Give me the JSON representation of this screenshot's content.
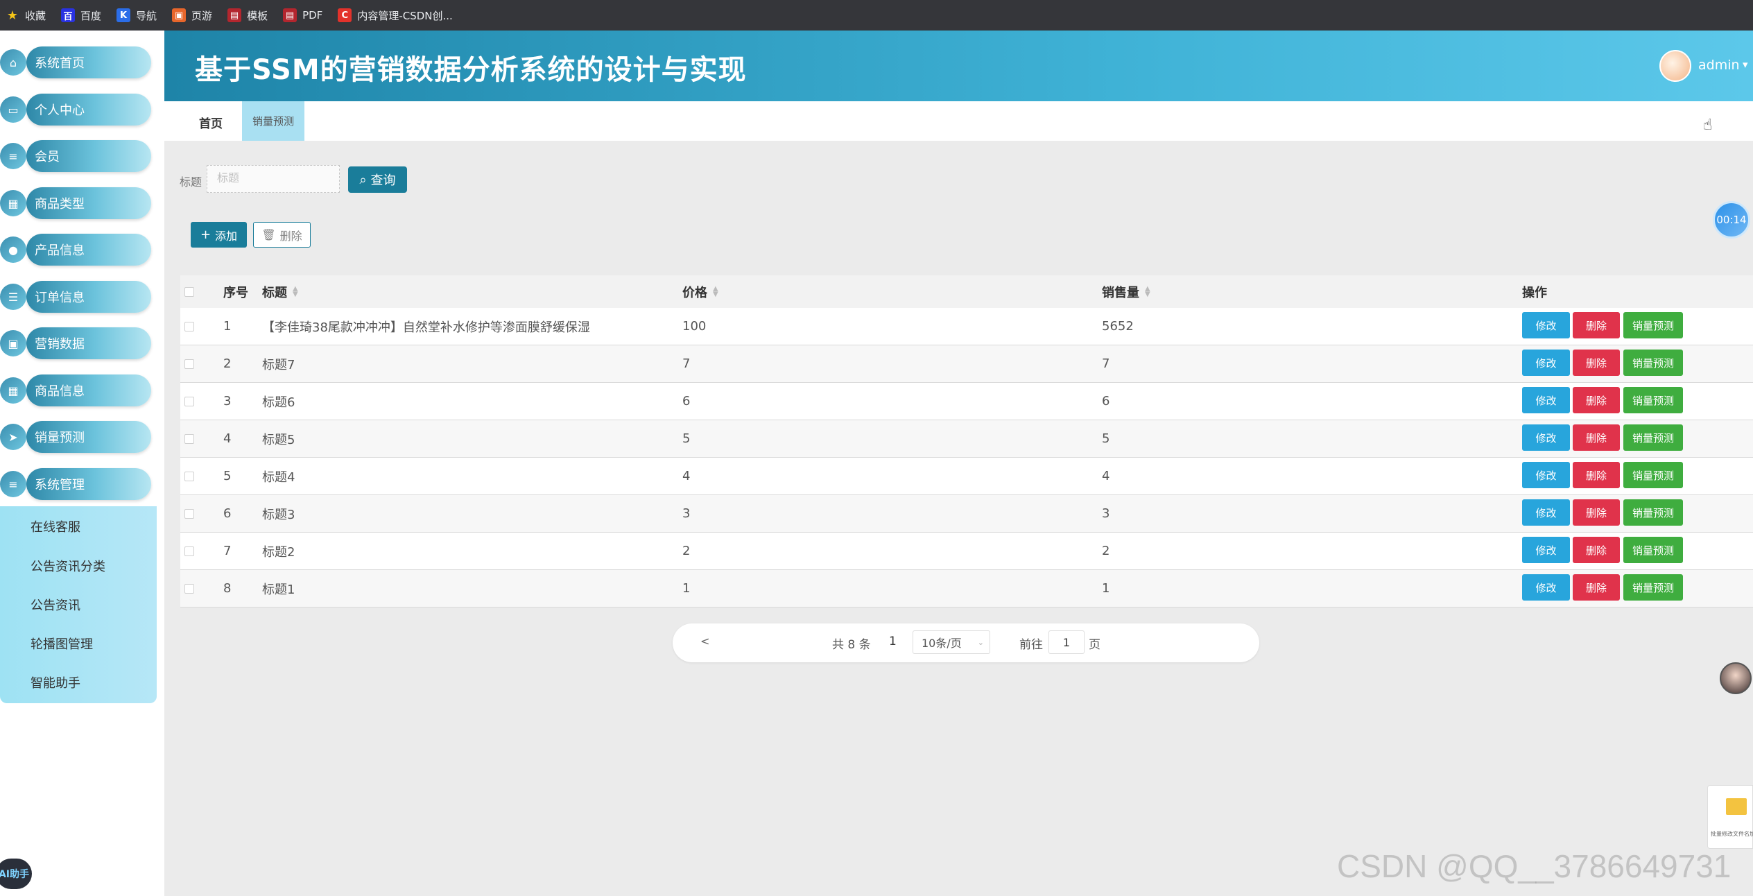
{
  "bookmarks": [
    {
      "label": "收藏",
      "icon": "star-icon",
      "color": "#f5c518"
    },
    {
      "label": "百度",
      "icon": "baidu-icon",
      "color": "#2932e1"
    },
    {
      "label": "导航",
      "icon": "nav-icon",
      "color": "#2b6de8"
    },
    {
      "label": "页游",
      "icon": "game-icon",
      "color": "#e8662b"
    },
    {
      "label": "模板",
      "icon": "template-icon",
      "color": "#b3262e"
    },
    {
      "label": "PDF",
      "icon": "pdf-icon",
      "color": "#b3262e"
    },
    {
      "label": "内容管理-CSDN创...",
      "icon": "csdn-icon",
      "color": "#e3322b"
    }
  ],
  "sidebar": {
    "items": [
      {
        "label": "系统首页",
        "icon": "home-icon"
      },
      {
        "label": "个人中心",
        "icon": "profile-icon"
      },
      {
        "label": "会员",
        "icon": "list-icon"
      },
      {
        "label": "商品类型",
        "icon": "grid-icon"
      },
      {
        "label": "产品信息",
        "icon": "bulb-icon"
      },
      {
        "label": "订单信息",
        "icon": "sliders-icon"
      },
      {
        "label": "营销数据",
        "icon": "camera-icon"
      },
      {
        "label": "商品信息",
        "icon": "grid-icon"
      },
      {
        "label": "销量预测",
        "icon": "send-icon"
      },
      {
        "label": "系统管理",
        "icon": "list-icon"
      }
    ],
    "submenu": [
      "在线客服",
      "公告资讯分类",
      "公告资讯",
      "轮播图管理",
      "智能助手"
    ],
    "ai_badge": "AI助手"
  },
  "header": {
    "title": "基于SSM的营销数据分析系统的设计与实现",
    "user": "admin"
  },
  "tabs": {
    "home": "首页",
    "active": "销量预测"
  },
  "search": {
    "label": "标题",
    "placeholder": "标题",
    "button": "查询"
  },
  "actions": {
    "add": "添加",
    "delete": "删除"
  },
  "timer": "00:14",
  "table": {
    "headers": {
      "index": "序号",
      "title": "标题",
      "price": "价格",
      "sales": "销售量",
      "ops": "操作"
    },
    "rows": [
      {
        "index": "1",
        "title": "【李佳琦38尾款冲冲冲】自然堂补水修护等渗面膜舒缓保湿",
        "price": "100",
        "sales": "5652"
      },
      {
        "index": "2",
        "title": "标题7",
        "price": "7",
        "sales": "7"
      },
      {
        "index": "3",
        "title": "标题6",
        "price": "6",
        "sales": "6"
      },
      {
        "index": "4",
        "title": "标题5",
        "price": "5",
        "sales": "5"
      },
      {
        "index": "5",
        "title": "标题4",
        "price": "4",
        "sales": "4"
      },
      {
        "index": "6",
        "title": "标题3",
        "price": "3",
        "sales": "3"
      },
      {
        "index": "7",
        "title": "标题2",
        "price": "2",
        "sales": "2"
      },
      {
        "index": "8",
        "title": "标题1",
        "price": "1",
        "sales": "1"
      }
    ],
    "row_buttons": {
      "edit": "修改",
      "remove": "删除",
      "predict": "销量预测"
    }
  },
  "pagination": {
    "prev": "<",
    "total": "共 8 条",
    "current": "1",
    "page_size": "10条/页",
    "goto_label": "前往",
    "goto_value": "1",
    "page_suffix": "页"
  },
  "side_card_text": "批量修改文件名加后缀",
  "watermark": "CSDN @QQ__3786649731"
}
